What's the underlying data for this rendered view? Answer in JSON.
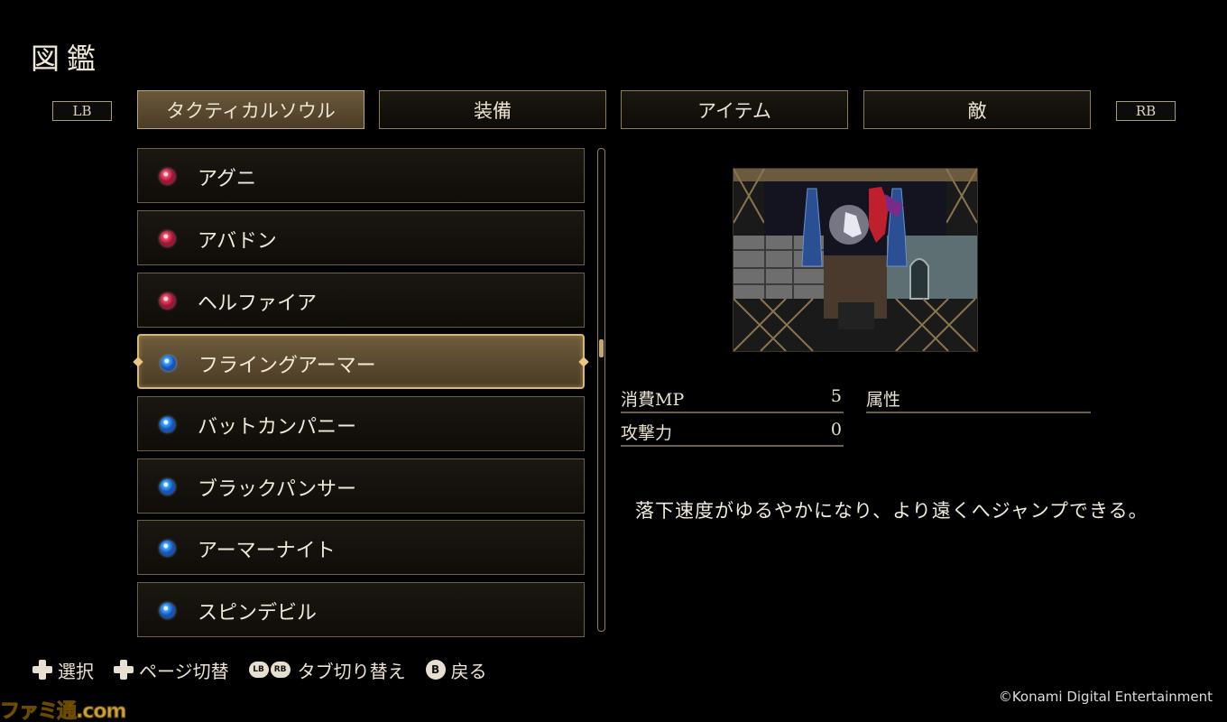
{
  "title": "図鑑",
  "shoulder": {
    "left": "LB",
    "right": "RB"
  },
  "tabs": [
    {
      "label": "タクティカルソウル",
      "active": true
    },
    {
      "label": "装備",
      "active": false
    },
    {
      "label": "アイテム",
      "active": false
    },
    {
      "label": "敵",
      "active": false
    }
  ],
  "souls": [
    {
      "name": "アグニ",
      "gem": "red"
    },
    {
      "name": "アバドン",
      "gem": "red"
    },
    {
      "name": "ヘルファイア",
      "gem": "red"
    },
    {
      "name": "フライングアーマー",
      "gem": "blue",
      "selected": true
    },
    {
      "name": "バットカンパニー",
      "gem": "blue"
    },
    {
      "name": "ブラックパンサー",
      "gem": "blue"
    },
    {
      "name": "アーマーナイト",
      "gem": "blue"
    },
    {
      "name": "スピンデビル",
      "gem": "blue"
    }
  ],
  "scroll_position": 0.41,
  "details": {
    "mp_label": "消費MP",
    "mp_value": "5",
    "attack_label": "攻撃力",
    "attack_value": "0",
    "attribute_label": "属性",
    "description": "落下速度がゆるやかになり、より遠くへジャンプできる。"
  },
  "controls": {
    "select": "選択",
    "page": "ページ切替",
    "lb_glyph": "LB",
    "rb_glyph": "RB",
    "tab_switch": "タブ切り替え",
    "b_glyph": "B",
    "back": "戻る"
  },
  "copyright": "©Konami Digital Entertainment",
  "watermark": "ファミ通.com",
  "colors": {
    "accent_gold": "#c2a870",
    "gem_red": "#f04a6c",
    "gem_blue": "#3fa6ff"
  }
}
